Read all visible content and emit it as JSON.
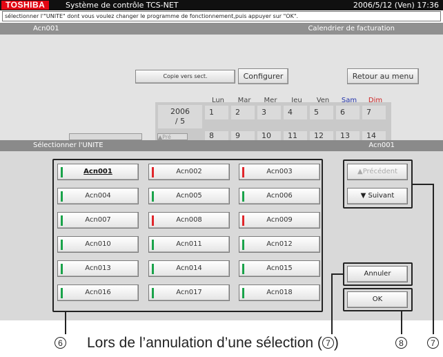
{
  "header": {
    "brand": "TOSHIBA",
    "title": "Système de contrôle TCS-NET",
    "datetime": "2006/5/12 (Ven) 17:36"
  },
  "instruction": "sélectionner l'\"UNITE\" dont vous voulez changer le programme de fonctionnement,puis appuyer sur \"OK\".",
  "infobar": {
    "unit": "Acn001",
    "title": "Calendrier de facturation"
  },
  "background_screen": {
    "copy_button": "Copie vers sect.",
    "configure_button": "Configurer",
    "return_button": "Retour au menu",
    "prev_small": "▲Pré",
    "year": "2006",
    "month": "/ 5",
    "days": [
      {
        "label": "Lun",
        "color": "#444444"
      },
      {
        "label": "Mar",
        "color": "#444444"
      },
      {
        "label": "Mer",
        "color": "#444444"
      },
      {
        "label": "Jeu",
        "color": "#444444"
      },
      {
        "label": "Ven",
        "color": "#444444"
      },
      {
        "label": "Sam",
        "color": "#2233aa"
      },
      {
        "label": "Dim",
        "color": "#cc2222"
      }
    ],
    "week1": [
      "1",
      "2",
      "3",
      "4",
      "5",
      "6",
      "7"
    ],
    "week2": [
      "8",
      "9",
      "10",
      "11",
      "12",
      "13",
      "14"
    ]
  },
  "selection": {
    "header_label": "Sélectionner l'UNITE",
    "header_unit": "Acn001",
    "units": [
      {
        "name": "Acn001",
        "status": "green",
        "selected": true
      },
      {
        "name": "Acn002",
        "status": "red"
      },
      {
        "name": "Acn003",
        "status": "red"
      },
      {
        "name": "Acn004",
        "status": "green"
      },
      {
        "name": "Acn005",
        "status": "green"
      },
      {
        "name": "Acn006",
        "status": "green"
      },
      {
        "name": "Acn007",
        "status": "green"
      },
      {
        "name": "Acn008",
        "status": "red"
      },
      {
        "name": "Acn009",
        "status": "red"
      },
      {
        "name": "Acn010",
        "status": "green"
      },
      {
        "name": "Acn011",
        "status": "green"
      },
      {
        "name": "Acn012",
        "status": "green"
      },
      {
        "name": "Acn013",
        "status": "green"
      },
      {
        "name": "Acn014",
        "status": "green"
      },
      {
        "name": "Acn015",
        "status": "green"
      },
      {
        "name": "Acn016",
        "status": "green"
      },
      {
        "name": "Acn017",
        "status": "green"
      },
      {
        "name": "Acn018",
        "status": "green"
      }
    ],
    "status_colors": {
      "green": "#1aa34a",
      "red": "#e0262b"
    },
    "prev_button": "▲Précédent",
    "next_button": "▼ Suivant",
    "cancel_button": "Annuler",
    "ok_button": "OK"
  },
  "caption": {
    "marker6": "6",
    "text": "Lors de l’annulation d’une sélection (",
    "text_marker": "7",
    "text_close": ")",
    "marker8": "8",
    "marker7": "7"
  }
}
